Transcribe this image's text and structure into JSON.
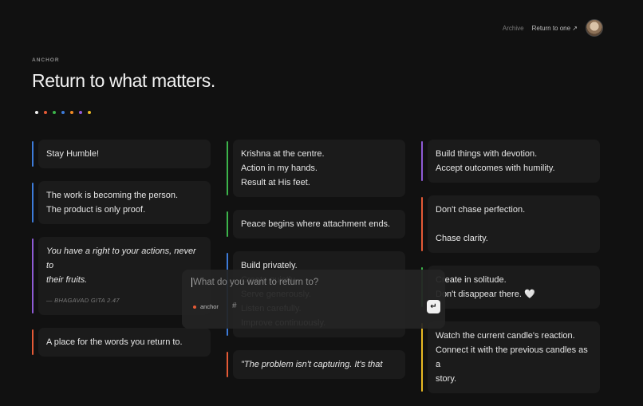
{
  "nav": {
    "archive": "Archive",
    "return_to_one": "Return to one ↗"
  },
  "header": {
    "eyebrow": "ANCHOR",
    "title": "Return to what matters."
  },
  "colors": {
    "dots": [
      "#f0f0f0",
      "#e55a36",
      "#3cb44b",
      "#3d7bd9",
      "#f08a24",
      "#8f5bd6",
      "#e8b923"
    ],
    "blue": "#3d7bd9",
    "purple": "#8f5bd6",
    "orange": "#e55a36",
    "green": "#3cb44b",
    "yellow": "#e8b923",
    "accent": "#e55a36"
  },
  "columns": [
    [
      {
        "color": "#3d7bd9",
        "lines": [
          "Stay Humble!"
        ]
      },
      {
        "color": "#3d7bd9",
        "lines": [
          "The work is becoming the person.",
          "The product is only proof."
        ]
      },
      {
        "color": "#8f5bd6",
        "italic": true,
        "lines": [
          "You have a right to your actions, never to",
          "their fruits."
        ],
        "attribution": "— BHAGAVAD GITA 2.47"
      },
      {
        "color": "#e55a36",
        "lines": [
          "A place for the words you return to."
        ]
      }
    ],
    [
      {
        "color": "#3cb44b",
        "lines": [
          "Krishna at the centre.",
          "Action in my hands.",
          "Result at His feet."
        ]
      },
      {
        "color": "#3cb44b",
        "lines": [
          "Peace begins where attachment ends."
        ]
      },
      {
        "color": "#3d7bd9",
        "lines": [
          "Build privately.",
          "Create quietly.",
          "Serve generously.",
          "Listen carefully.",
          "Improve continuously."
        ]
      },
      {
        "color": "#e55a36",
        "italic": true,
        "lines": [
          "\"The problem isn't capturing. It's that"
        ]
      }
    ],
    [
      {
        "color": "#8f5bd6",
        "lines": [
          "Build things with devotion.",
          "Accept outcomes with humility."
        ]
      },
      {
        "color": "#e55a36",
        "lines": [
          "Don't chase perfection.",
          "",
          "Chase clarity."
        ]
      },
      {
        "color": "#3cb44b",
        "lines": [
          "Create in solitude.",
          "Don't disappear there. 🤍"
        ]
      },
      {
        "color": "#e8b923",
        "lines": [
          "Watch the current candle's reaction.",
          "Connect it with the previous candles as a",
          "story."
        ]
      }
    ]
  ],
  "composer": {
    "placeholder": "What do you want to return to?",
    "value": "",
    "tag": "anchor",
    "hash": "#",
    "submit": "↵"
  }
}
